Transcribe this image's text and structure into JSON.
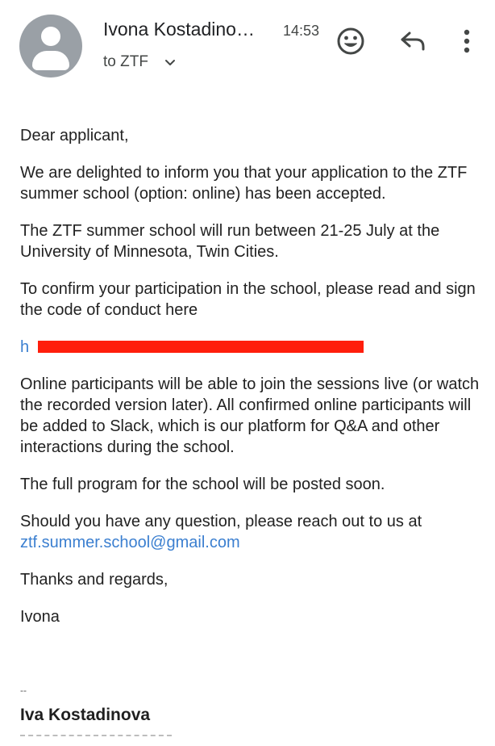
{
  "header": {
    "sender": "Ivona Kostadino…",
    "time": "14:53",
    "recipient": "to ZTF",
    "icons": [
      "account-circle",
      "chevron-down",
      "emoji",
      "reply",
      "more-vert"
    ]
  },
  "body": {
    "greeting": "Dear applicant,",
    "para1": "We are delighted to inform you that your application to the ZTF summer school (option: online) has been accepted.",
    "para2": "The ZTF summer school will run between 21-25 July at the University of Minnesota, Twin Cities.",
    "para3": "To confirm your participation in the school, please read and sign the code of conduct here",
    "link_visible_fragment": "h",
    "para4": "Online participants will be able to join the sessions live (or watch the recorded version later).  All confirmed online participants will be added to Slack, which is our platform for Q&A and other interactions during the school.",
    "para5": "The full program for the school will be posted soon.",
    "para6_prefix": "Should you have any question, please reach out to us at",
    "email": "ztf.summer.school@gmail.com",
    "closing": "Thanks and regards,",
    "signoff": "Ivona"
  },
  "signature": {
    "dash": "--",
    "name": "Iva Kostadinova"
  },
  "colors": {
    "link": "#3b7fd0",
    "redaction": "#ff1e0c",
    "avatar": "#9aa0a6"
  }
}
